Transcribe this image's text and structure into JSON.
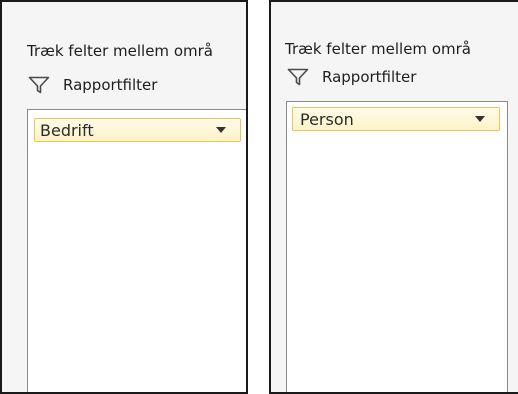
{
  "panels": [
    {
      "heading": "Træk felter mellem områ",
      "section_label": "Rapportfilter",
      "section_icon": "filter-icon",
      "fields": [
        {
          "label": "Bedrift",
          "icon": "chevron-down-icon"
        }
      ]
    },
    {
      "heading": "Træk felter mellem områ",
      "section_label": "Rapportfilter",
      "section_icon": "filter-icon",
      "fields": [
        {
          "label": "Person",
          "icon": "chevron-down-icon"
        }
      ]
    }
  ],
  "colors": {
    "chip_background": "#fef3c7",
    "chip_border": "#e9c35e",
    "panel_background": "#f5f5f5",
    "drop_area_border": "#8a8a8a"
  }
}
